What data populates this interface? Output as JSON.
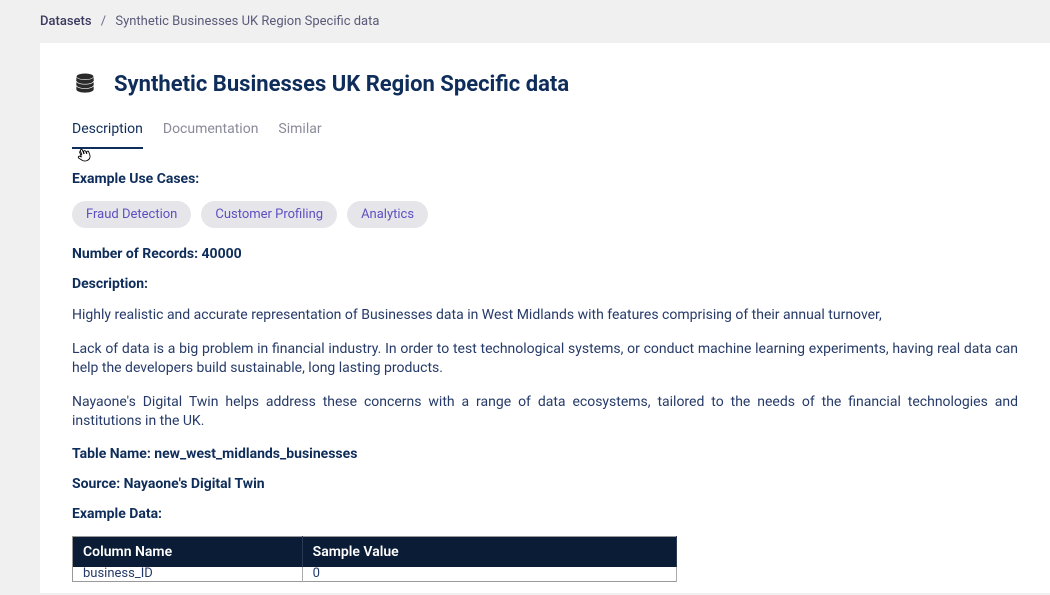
{
  "breadcrumb": {
    "root": "Datasets",
    "sep": "/",
    "current": "Synthetic Businesses UK Region Specific data"
  },
  "page_title": "Synthetic Businesses UK Region Specific data",
  "tabs": {
    "description": "Description",
    "documentation": "Documentation",
    "similar": "Similar"
  },
  "sections": {
    "use_cases_title": "Example Use Cases:",
    "records_label": "Number of Records:",
    "records_value": "40000",
    "desc_title": "Description:",
    "desc_para1": "Highly realistic and accurate representation of Businesses data in West Midlands with features comprising of their annual turnover,",
    "desc_para2": "Lack of data is a big problem in financial industry. In order to test technological systems, or conduct machine learning experiments, having real data can help the developers build sustainable, long lasting products.",
    "desc_para3": "Nayaone's Digital Twin helps address these concerns with a range of data ecosystems, tailored to the needs of the financial technologies and institutions in the UK.",
    "table_name_label": "Table Name:",
    "table_name_value": "new_west_midlands_businesses",
    "source_label": "Source:",
    "source_value": "Nayaone's Digital Twin",
    "example_data_title": "Example Data:"
  },
  "tags": {
    "fraud": "Fraud Detection",
    "profiling": "Customer Profiling",
    "analytics": "Analytics"
  },
  "table": {
    "col1": "Column Name",
    "col2": "Sample Value",
    "row1_col1": "business_ID",
    "row1_col2": "0"
  }
}
